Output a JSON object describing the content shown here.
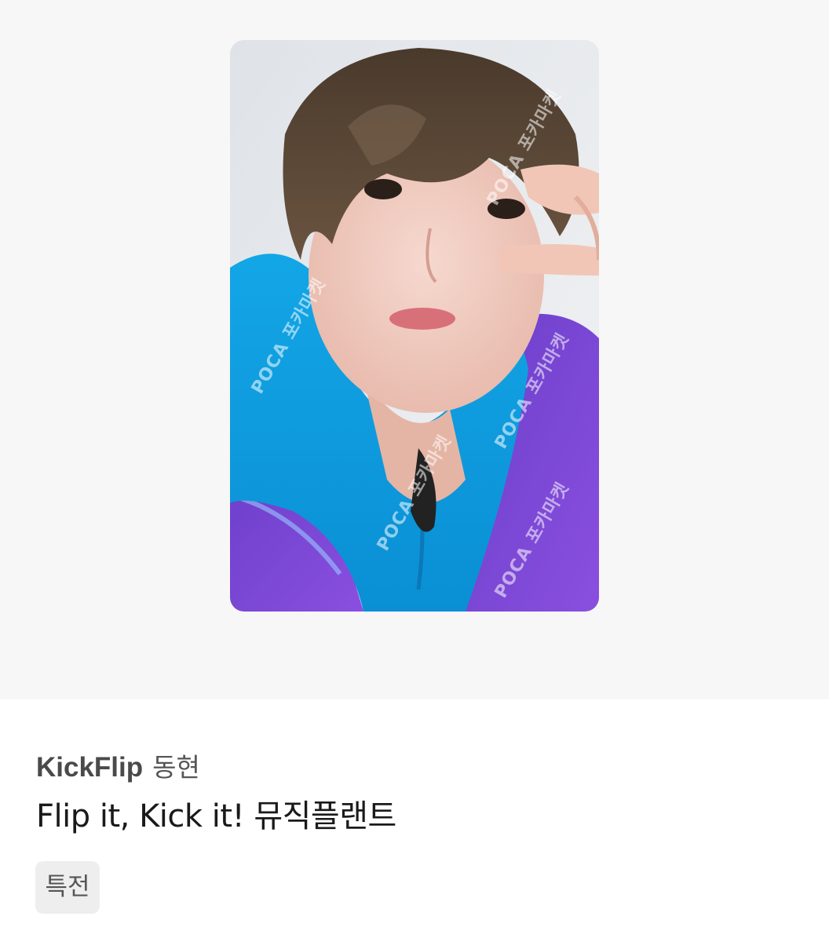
{
  "product": {
    "group_name": "KickFlip",
    "member_name": "동현",
    "title": "Flip it, Kick it! 뮤직플랜트",
    "tag": "특전"
  },
  "image": {
    "description_icon": "photocard-image",
    "watermark_text": "POCA 포카마켓"
  }
}
